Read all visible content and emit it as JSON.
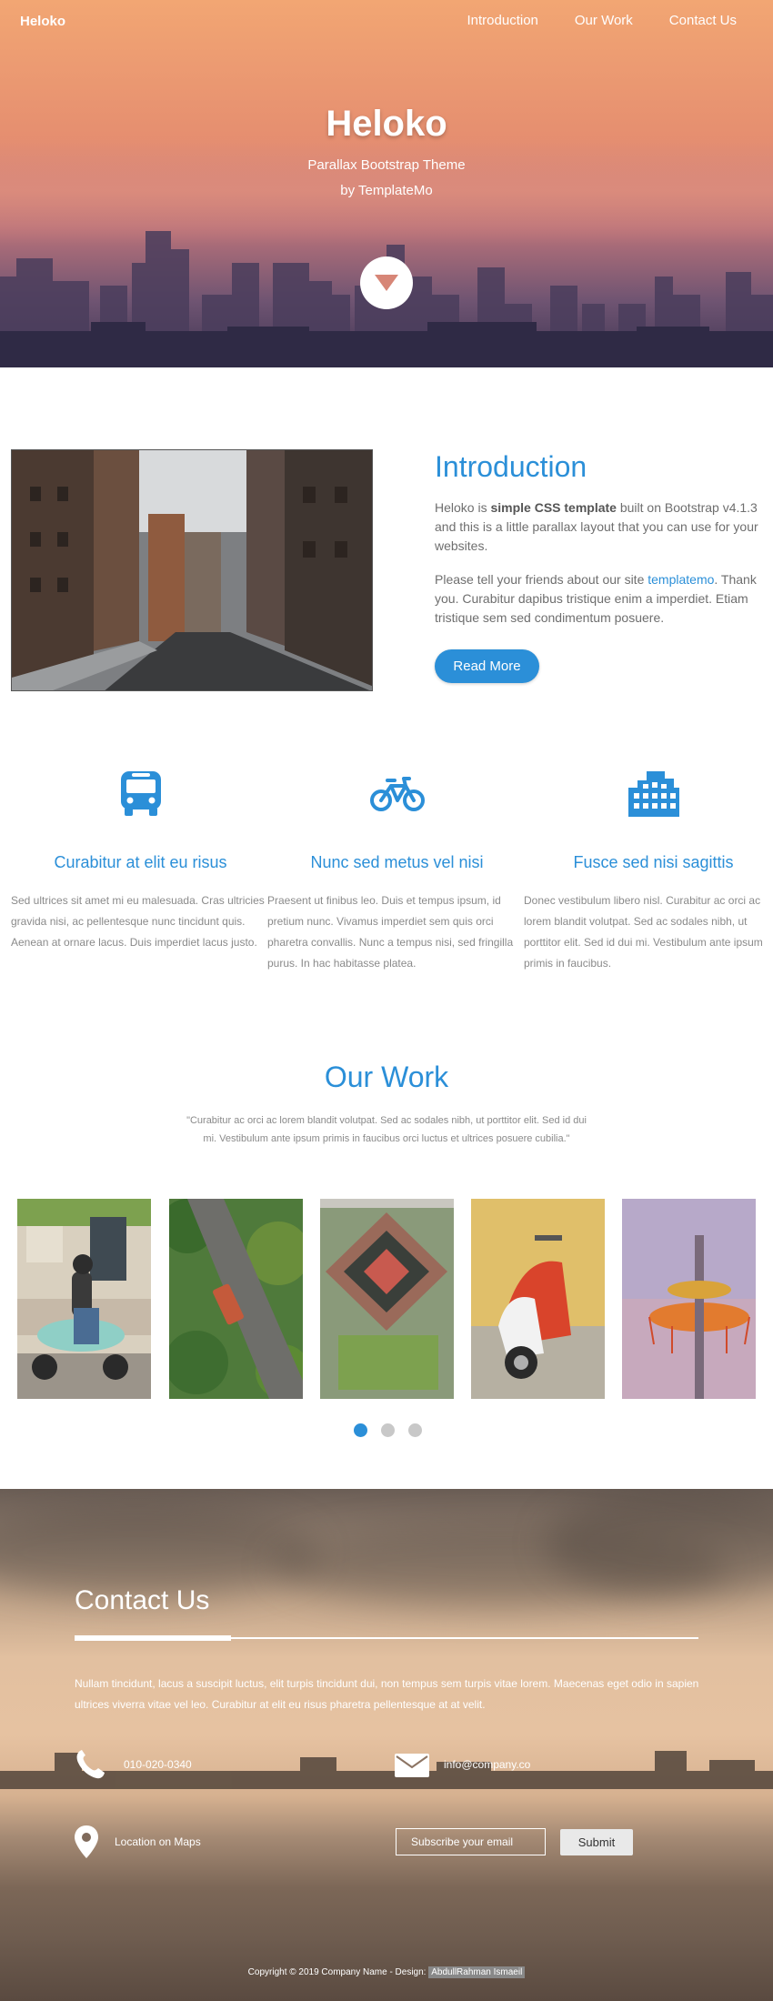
{
  "nav": {
    "brand": "Heloko",
    "links": [
      "Introduction",
      "Our Work",
      "Contact Us"
    ]
  },
  "hero": {
    "title": "Heloko",
    "subtitle": "Parallax Bootstrap Theme",
    "byline": "by TemplateMo",
    "down_icon": "chevron-down-icon"
  },
  "intro": {
    "title": "Introduction",
    "p1_prefix": "Heloko is ",
    "p1_bold": "simple CSS template",
    "p1_suffix": " built on Bootstrap v4.1.3 and this is a little parallax layout that you can use for your websites.",
    "p2_prefix": "Please tell your friends about our site ",
    "p2_link": "templatemo",
    "p2_suffix": ". Thank you. Curabitur dapibus tristique enim a imperdiet. Etiam tristique sem sed condimentum posuere.",
    "button": "Read More"
  },
  "features": [
    {
      "icon": "bus-icon",
      "title": "Curabitur at elit eu risus",
      "text": "Sed ultrices sit amet mi eu malesuada. Cras ultricies gravida nisi, ac pellentesque nunc tincidunt quis. Aenean at ornare lacus. Duis imperdiet lacus justo."
    },
    {
      "icon": "bicycle-icon",
      "title": "Nunc sed metus vel nisi",
      "text": "Praesent ut finibus leo. Duis et tempus ipsum, id pretium nunc. Vivamus imperdiet sem quis orci pharetra convallis. Nunc a tempus nisi, sed fringilla purus. In hac habitasse platea."
    },
    {
      "icon": "building-icon",
      "title": "Fusce sed nisi sagittis",
      "text": "Donec vestibulum libero nisl. Curabitur ac orci ac lorem blandit volutpat. Sed ac sodales nibh, ut porttitor elit. Sed id dui mi. Vestibulum ante ipsum primis in faucibus."
    }
  ],
  "work": {
    "title": "Our Work",
    "subtitle": "\"Curabitur ac orci ac lorem blandit volutpat. Sed ac sodales nibh, ut porttitor elit. Sed id dui mi. Vestibulum ante ipsum primis in faucibus orci luctus et ultrices posuere cubilia.\"",
    "gallery": [
      "scooter-rider",
      "aerial-road-bus",
      "aerial-building",
      "red-vespa",
      "ferris-wheel"
    ],
    "pages": 3,
    "active_page": 1
  },
  "contact": {
    "title": "Contact Us",
    "text": "Nullam tincidunt, lacus a suscipit luctus, elit turpis tincidunt dui, non tempus sem turpis vitae lorem. Maecenas eget odio in sapien ultrices viverra vitae vel leo. Curabitur at elit eu risus pharetra pellentesque at at velit.",
    "phone": "010-020-0340",
    "email": "info@company.co",
    "map": "Location on Maps",
    "subscribe_placeholder": "Subscribe your email",
    "subscribe_button": "Submit"
  },
  "footer": {
    "text": "Copyright © 2019 Company Name - Design: ",
    "designer": "AbdullRahman Ismaeil"
  },
  "colors": {
    "accent": "#2b8fd8"
  }
}
